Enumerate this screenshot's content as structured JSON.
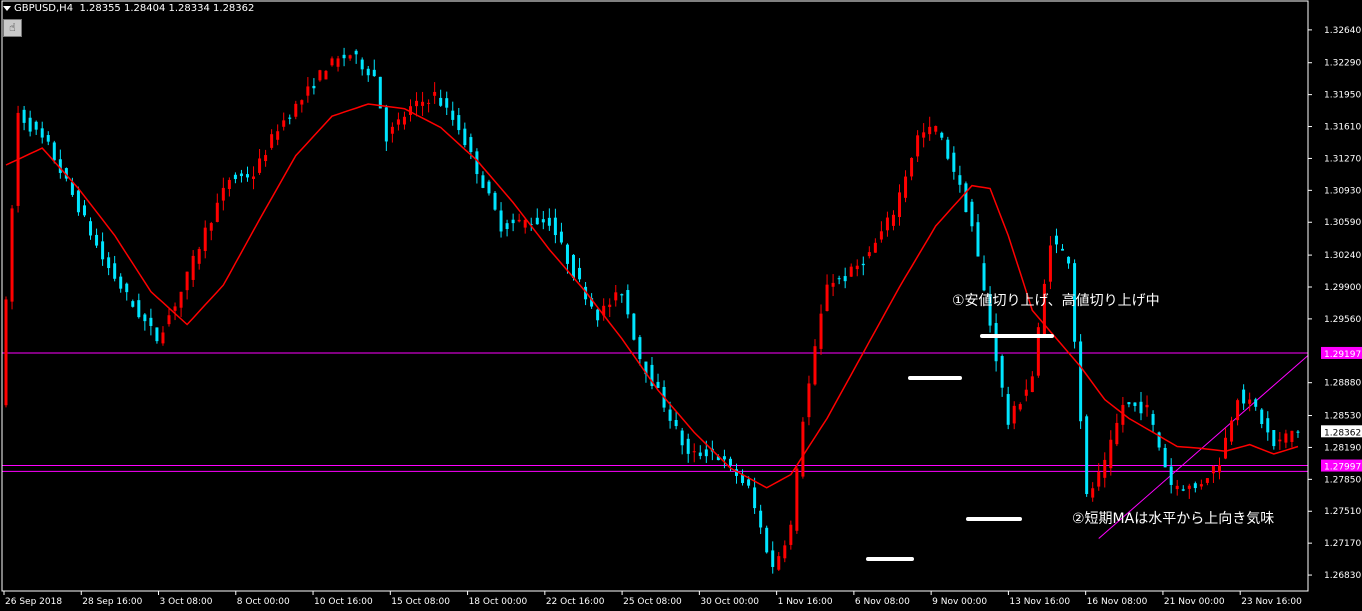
{
  "header": {
    "symbol": "GBPUSD,H4",
    "ohlc": "1.28355 1.28404 1.28334 1.28362"
  },
  "toolbar": {
    "tool_icon": "hand-pointer-icon"
  },
  "annotations": {
    "note1": "①安値切り上げ、高値切り上げ中",
    "note2": "②短期MAは水平から上向き気味"
  },
  "colors": {
    "background": "#000000",
    "bull": "#ff0000",
    "bear": "#00e5ff",
    "ma": "#ff0000",
    "level": "#ff00ff",
    "axis": "#ffffff"
  },
  "chart_data": {
    "type": "candlestick",
    "symbol": "GBPUSD",
    "timeframe": "H4",
    "ylim": [
      1.2666,
      1.3282
    ],
    "y_ticks": [
      "1.32640",
      "1.32290",
      "1.31950",
      "1.31610",
      "1.31270",
      "1.30930",
      "1.30590",
      "1.30240",
      "1.29900",
      "1.29560",
      "1.29197",
      "1.28880",
      "1.28530",
      "1.28362",
      "1.28190",
      "1.27997",
      "1.27850",
      "1.27510",
      "1.27170",
      "1.26830"
    ],
    "x_ticks": [
      "26 Sep 2018",
      "28 Sep 16:00",
      "3 Oct 08:00",
      "8 Oct 00:00",
      "10 Oct 16:00",
      "15 Oct 08:00",
      "18 Oct 00:00",
      "22 Oct 16:00",
      "25 Oct 08:00",
      "30 Oct 00:00",
      "1 Nov 16:00",
      "6 Nov 08:00",
      "9 Nov 00:00",
      "13 Nov 16:00",
      "16 Nov 08:00",
      "21 Nov 00:00",
      "23 Nov 16:00"
    ],
    "last_price": "1.28362",
    "horizontal_levels": [
      {
        "price": 1.29197,
        "label": "1.29197"
      },
      {
        "price": 1.27997,
        "label": "1.27997"
      },
      {
        "price": 1.27935,
        "label": ""
      }
    ],
    "trendline": {
      "from": {
        "index": 181,
        "price": 1.2722
      },
      "to": {
        "index": 270,
        "price": 1.2917
      }
    },
    "key_path": [
      [
        0,
        1.287
      ],
      [
        3,
        1.3175
      ],
      [
        8,
        1.314
      ],
      [
        13,
        1.3075
      ],
      [
        17,
        1.302
      ],
      [
        22,
        1.297
      ],
      [
        26,
        1.2935
      ],
      [
        30,
        1.2985
      ],
      [
        34,
        1.305
      ],
      [
        38,
        1.3105
      ],
      [
        42,
        1.311
      ],
      [
        46,
        1.316
      ],
      [
        50,
        1.319
      ],
      [
        54,
        1.3225
      ],
      [
        58,
        1.3238
      ],
      [
        62,
        1.3215
      ],
      [
        64,
        1.315
      ],
      [
        68,
        1.318
      ],
      [
        72,
        1.3195
      ],
      [
        76,
        1.316
      ],
      [
        79,
        1.3115
      ],
      [
        83,
        1.3055
      ],
      [
        87,
        1.306
      ],
      [
        91,
        1.306
      ],
      [
        95,
        1.3005
      ],
      [
        99,
        1.296
      ],
      [
        103,
        1.2985
      ],
      [
        106,
        1.2915
      ],
      [
        110,
        1.2865
      ],
      [
        114,
        1.281
      ],
      [
        118,
        1.2815
      ],
      [
        122,
        1.279
      ],
      [
        124,
        1.2775
      ],
      [
        128,
        1.269
      ],
      [
        131,
        1.2735
      ],
      [
        133,
        1.285
      ],
      [
        137,
        1.2995
      ],
      [
        140,
        1.3
      ],
      [
        144,
        1.3025
      ],
      [
        148,
        1.307
      ],
      [
        152,
        1.315
      ],
      [
        155,
        1.316
      ],
      [
        158,
        1.3115
      ],
      [
        161,
        1.3055
      ],
      [
        164,
        1.295
      ],
      [
        167,
        1.2845
      ],
      [
        171,
        1.2895
      ],
      [
        174,
        1.304
      ],
      [
        177,
        1.302
      ],
      [
        180,
        1.2765
      ],
      [
        183,
        1.28
      ],
      [
        186,
        1.2865
      ],
      [
        190,
        1.286
      ],
      [
        194,
        1.278
      ],
      [
        198,
        1.2775
      ],
      [
        202,
        1.2805
      ],
      [
        205,
        1.2875
      ],
      [
        208,
        1.286
      ],
      [
        211,
        1.282
      ],
      [
        214,
        1.2836
      ]
    ],
    "ma_path": [
      [
        0,
        1.312
      ],
      [
        6,
        1.3138
      ],
      [
        12,
        1.3095
      ],
      [
        18,
        1.3045
      ],
      [
        24,
        1.2985
      ],
      [
        30,
        1.295
      ],
      [
        36,
        1.2992
      ],
      [
        42,
        1.3062
      ],
      [
        48,
        1.313
      ],
      [
        54,
        1.3172
      ],
      [
        60,
        1.3185
      ],
      [
        66,
        1.318
      ],
      [
        72,
        1.316
      ],
      [
        78,
        1.3125
      ],
      [
        84,
        1.308
      ],
      [
        90,
        1.303
      ],
      [
        96,
        1.2985
      ],
      [
        102,
        1.2935
      ],
      [
        108,
        1.288
      ],
      [
        114,
        1.2835
      ],
      [
        120,
        1.2797
      ],
      [
        126,
        1.2776
      ],
      [
        130,
        1.279
      ],
      [
        136,
        1.285
      ],
      [
        142,
        1.292
      ],
      [
        148,
        1.299
      ],
      [
        154,
        1.3055
      ],
      [
        160,
        1.3098
      ],
      [
        163,
        1.3095
      ],
      [
        166,
        1.3045
      ],
      [
        170,
        1.2965
      ],
      [
        174,
        1.2935
      ],
      [
        178,
        1.2905
      ],
      [
        182,
        1.287
      ],
      [
        186,
        1.285
      ],
      [
        190,
        1.2835
      ],
      [
        194,
        1.282
      ],
      [
        198,
        1.2818
      ],
      [
        202,
        1.2815
      ],
      [
        206,
        1.2822
      ],
      [
        210,
        1.2812
      ],
      [
        214,
        1.282
      ]
    ]
  }
}
